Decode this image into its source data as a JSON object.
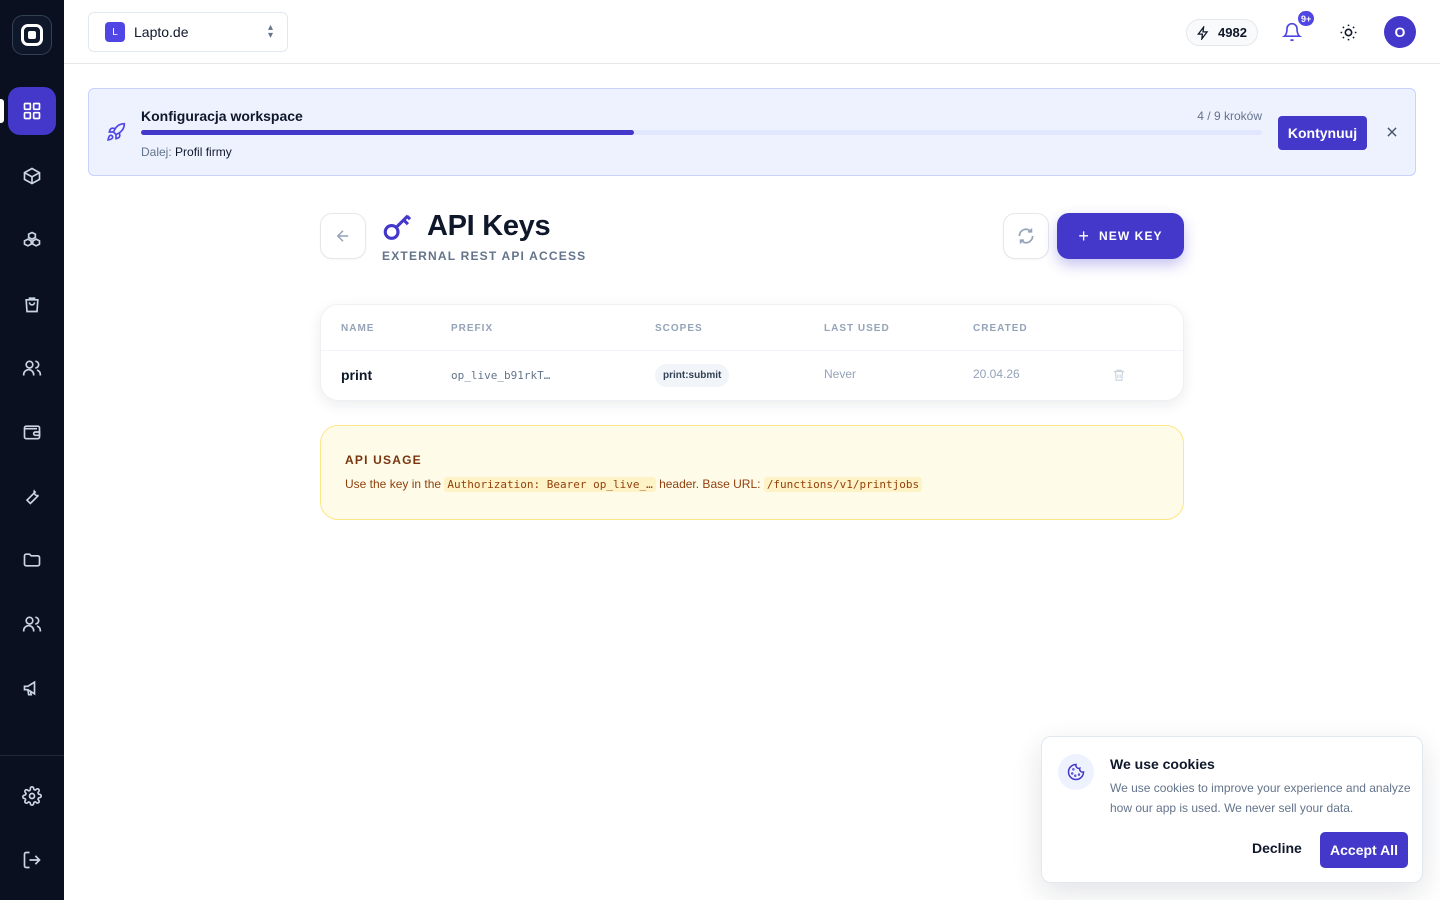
{
  "workspace": {
    "badge": "L",
    "name": "Lapto.de"
  },
  "topbar": {
    "credits": "4982",
    "notifications_badge": "9+",
    "avatar_initial": "O"
  },
  "onboarding": {
    "title": "Konfiguracja workspace",
    "steps": "4 / 9 kroków",
    "progress": 0.44,
    "next_label": "Dalej:",
    "next_step": "Profil firmy",
    "continue_label": "Kontynuuj"
  },
  "page": {
    "title": "API Keys",
    "subtitle": "EXTERNAL REST API ACCESS",
    "new_key_label": "NEW KEY"
  },
  "table": {
    "headers": {
      "name": "NAME",
      "prefix": "PREFIX",
      "scopes": "SCOPES",
      "last_used": "LAST USED",
      "created": "CREATED"
    },
    "rows": [
      {
        "name": "print",
        "prefix": "op_live_b91rkT…",
        "scope": "print:submit",
        "last_used": "Never",
        "created": "20.04.26"
      }
    ]
  },
  "usage": {
    "title": "API USAGE",
    "text_1": "Use the key in the",
    "code_1": "Authorization: Bearer op_live_…",
    "text_2": "header. Base URL:",
    "code_2": "/functions/v1/printjobs"
  },
  "cookie": {
    "title": "We use cookies",
    "text": "We use cookies to improve your experience and analyze how our app is used. We never sell your data.",
    "decline": "Decline",
    "accept": "Accept All"
  },
  "colors": {
    "accent": "#4338ca",
    "sidebar": "#0b1020",
    "usage_bg": "#fefce8"
  },
  "icons": {
    "sidebar": [
      "dashboard-icon",
      "box-icon",
      "boxes-icon",
      "shopping-bag-icon",
      "users-icon",
      "wallet-icon",
      "wrench-icon",
      "folder-icon",
      "team-icon",
      "megaphone-icon",
      "settings-icon",
      "logout-icon"
    ]
  }
}
